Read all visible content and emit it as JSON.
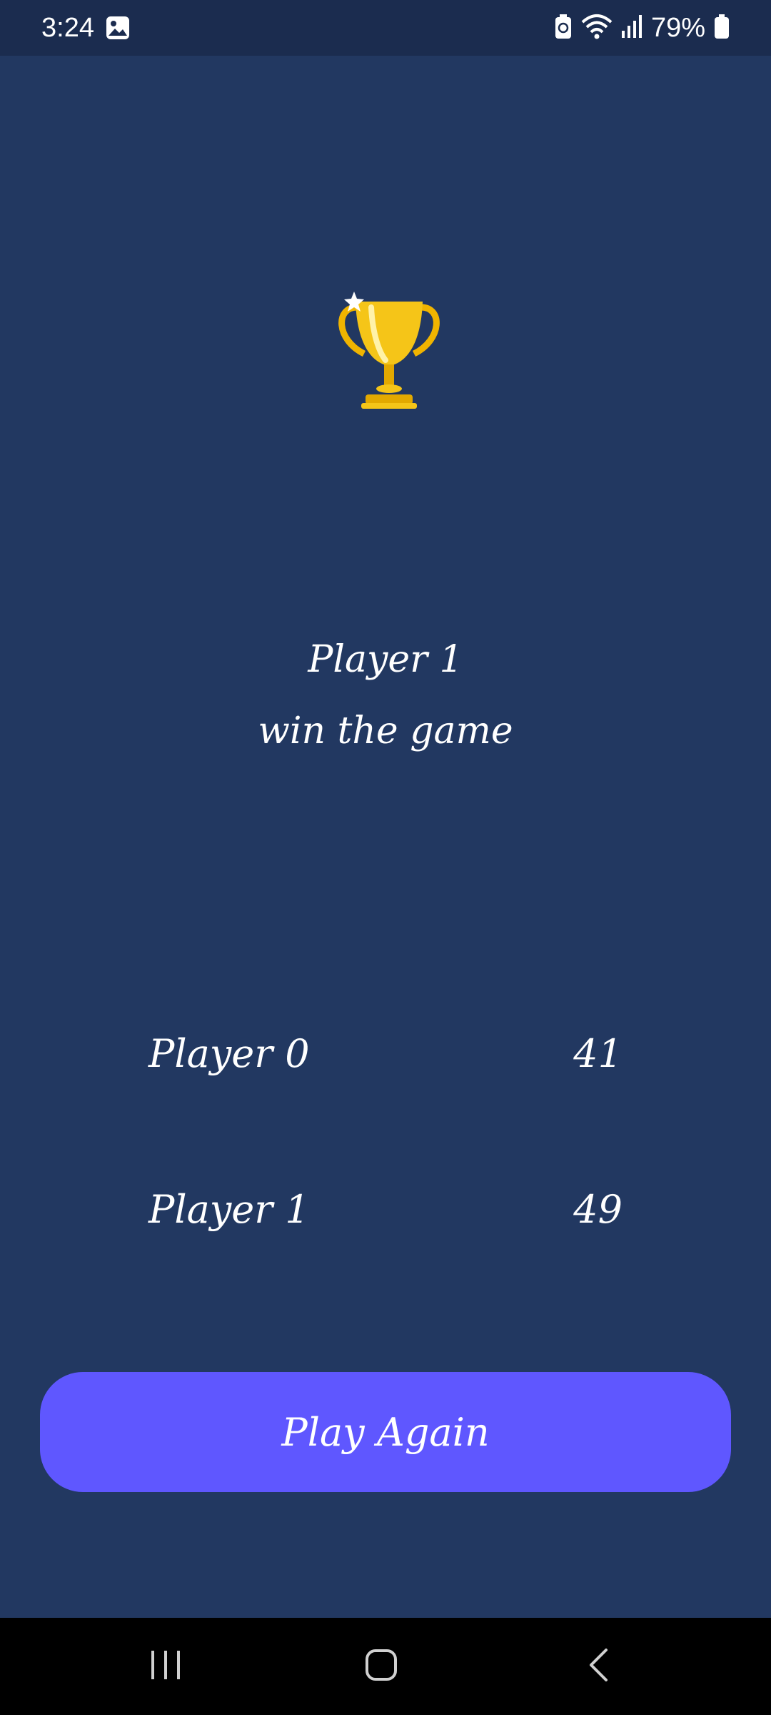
{
  "status_bar": {
    "time": "3:24",
    "battery_percent": "79%",
    "icons": [
      "gallery-icon",
      "battery-saver-icon",
      "wifi-icon",
      "signal-icon",
      "battery-icon"
    ]
  },
  "result": {
    "winner_name": "Player 1",
    "caption": "win the game"
  },
  "scores": [
    {
      "player": "Player 0",
      "score": "41"
    },
    {
      "player": "Player 1",
      "score": "49"
    }
  ],
  "actions": {
    "play_again_label": "Play Again"
  },
  "nav_bar": {
    "icons": [
      "recents-icon",
      "home-icon",
      "back-icon"
    ]
  },
  "colors": {
    "background": "#223861",
    "status_bar": "#1b2c4f",
    "button": "#5f57ff",
    "text": "#ffffff",
    "trophy": "#f5c518"
  }
}
